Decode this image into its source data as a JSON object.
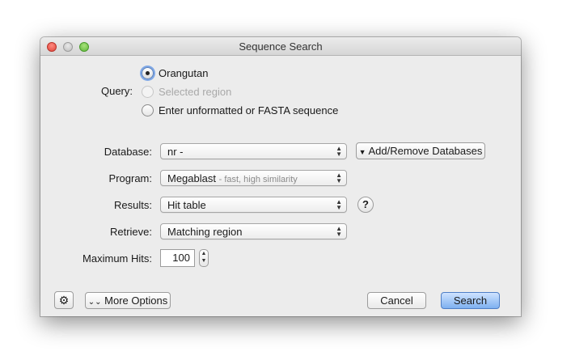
{
  "window": {
    "title": "Sequence Search"
  },
  "query": {
    "label": "Query:",
    "options": [
      {
        "label": "Orangutan",
        "checked": true,
        "disabled": false
      },
      {
        "label": "Selected region",
        "checked": false,
        "disabled": true
      },
      {
        "label": "Enter unformatted or FASTA sequence",
        "checked": false,
        "disabled": false
      }
    ]
  },
  "database": {
    "label": "Database:",
    "value": "nr -",
    "add_remove_label": "Add/Remove Databases"
  },
  "program": {
    "label": "Program:",
    "value": "Megablast",
    "detail": "- fast, high similarity"
  },
  "results": {
    "label": "Results:",
    "value": "Hit table",
    "help": "?"
  },
  "retrieve": {
    "label": "Retrieve:",
    "value": "Matching region"
  },
  "max_hits": {
    "label": "Maximum Hits:",
    "value": "100"
  },
  "footer": {
    "more_options_label": "More Options",
    "cancel_label": "Cancel",
    "search_label": "Search"
  },
  "colors": {
    "window_bg": "#ececec",
    "default_button": "#7eb0f0",
    "close_light": "#e0443a",
    "zoom_light": "#5fb83a"
  }
}
